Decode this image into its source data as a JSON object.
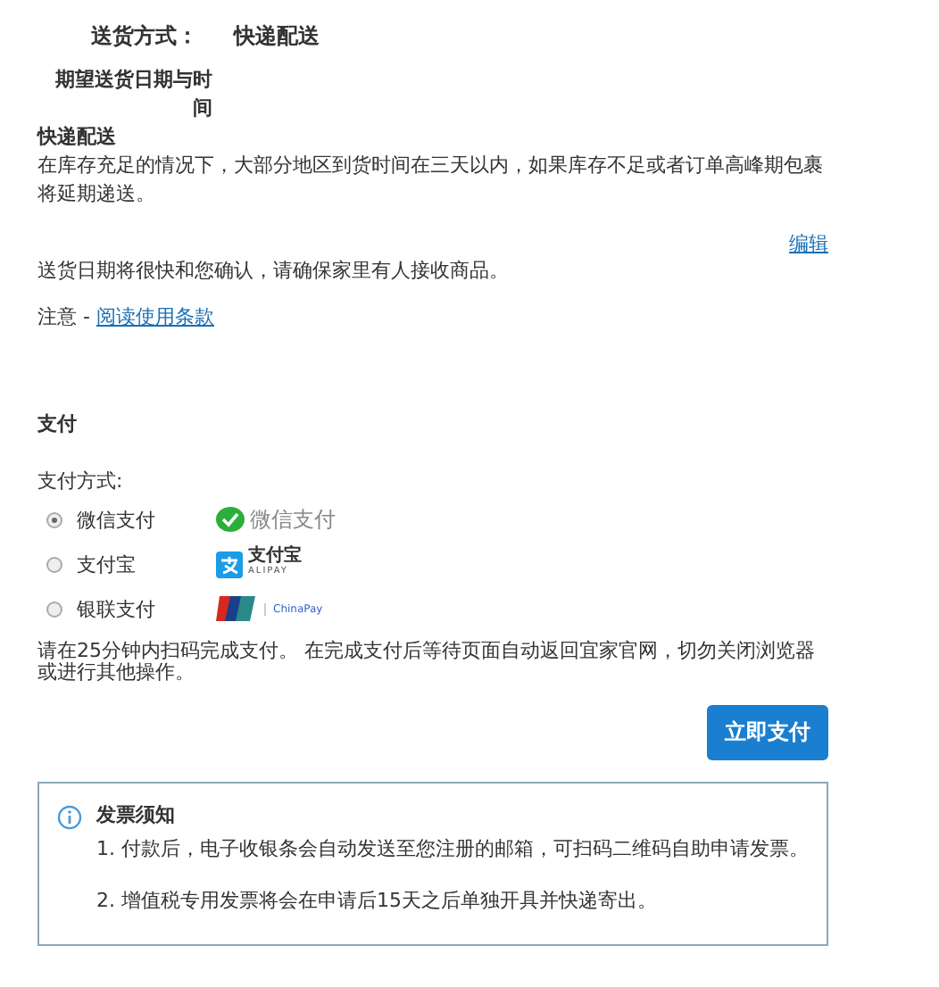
{
  "delivery": {
    "method_label": "送货方式：",
    "method_value": "快递配送",
    "date_label": "期望送货日期与时间",
    "express_title": "快递配送",
    "express_desc": "在库存充足的情况下，大部分地区到货时间在三天以内，如果库存不足或者订单高峰期包裹将延期递送。",
    "edit_link": "编辑",
    "confirm_note": "送货日期将很快和您确认，请确保家里有人接收商品。",
    "notice_label": "注意 - ",
    "terms_link": "阅读使用条款"
  },
  "payment": {
    "title": "支付",
    "method_label": "支付方式:",
    "options": [
      {
        "label": "微信支付",
        "selected": true,
        "kind": "wechat",
        "logo_text": [
          "微信支付"
        ]
      },
      {
        "label": "支付宝",
        "selected": false,
        "kind": "alipay",
        "logo_text": [
          "支付宝",
          "ALIPAY"
        ]
      },
      {
        "label": "银联支付",
        "selected": false,
        "kind": "unionpay",
        "logo_text": [
          "ChinaPay"
        ]
      }
    ],
    "instructions": "请在25分钟内扫码完成支付。 在完成支付后等待页面自动返回宜家官网，切勿关闭浏览器或进行其他操作。",
    "pay_button": "立即支付"
  },
  "invoice": {
    "title": "发票须知",
    "items": [
      "1. 付款后，电子收银条会自动发送至您注册的邮箱，可扫码二维码自助申请发票。",
      "2. 增值税专用发票将会在申请后15天之后单独开具并快递寄出。"
    ]
  }
}
